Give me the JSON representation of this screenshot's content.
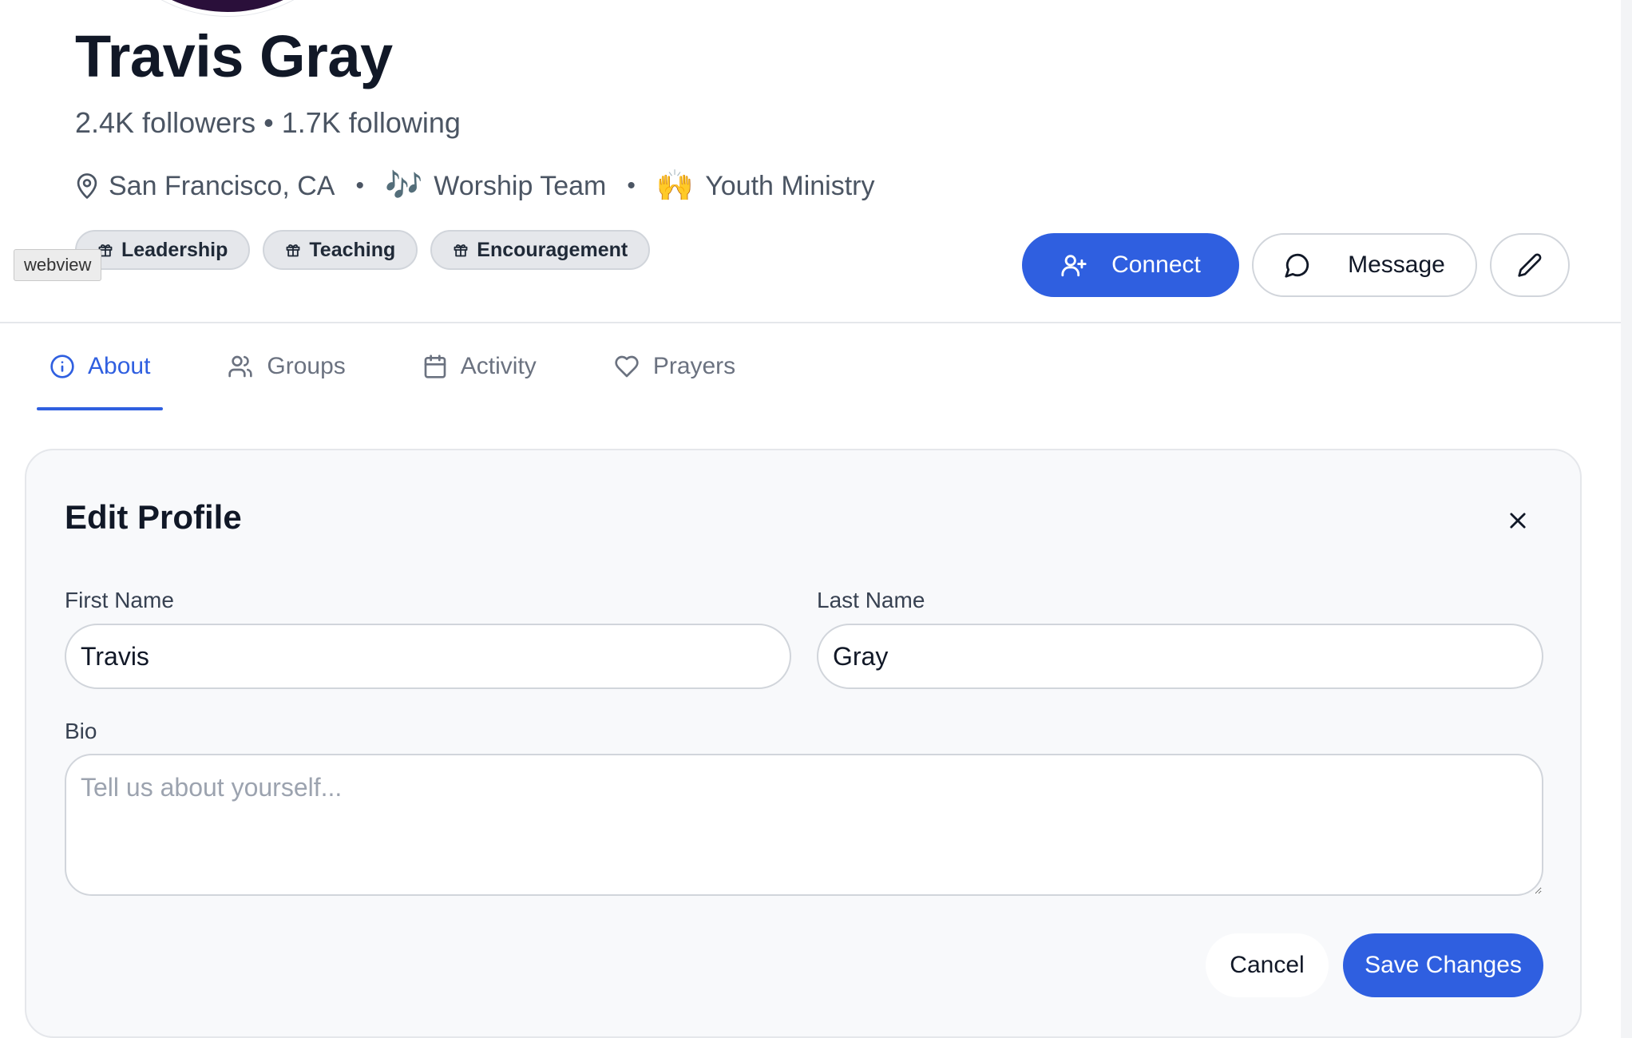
{
  "profile": {
    "name": "Travis Gray",
    "followers": "2.4K followers",
    "separator": "•",
    "following": "1.7K following",
    "location": "San Francisco, CA",
    "ministries": [
      {
        "emoji": "🎶",
        "label": "Worship Team"
      },
      {
        "emoji": "🙌",
        "label": "Youth Ministry"
      }
    ],
    "gifts": [
      "Leadership",
      "Teaching",
      "Encouragement"
    ]
  },
  "tooltip": "webview",
  "actions": {
    "connect": "Connect",
    "message": "Message"
  },
  "tabs": [
    {
      "label": "About",
      "icon": "info-icon",
      "active": true
    },
    {
      "label": "Groups",
      "icon": "users-icon",
      "active": false
    },
    {
      "label": "Activity",
      "icon": "calendar-icon",
      "active": false
    },
    {
      "label": "Prayers",
      "icon": "heart-icon",
      "active": false
    }
  ],
  "edit_form": {
    "title": "Edit Profile",
    "first_name_label": "First Name",
    "first_name_value": "Travis",
    "last_name_label": "Last Name",
    "last_name_value": "Gray",
    "bio_label": "Bio",
    "bio_placeholder": "Tell us about yourself...",
    "cancel_label": "Cancel",
    "save_label": "Save Changes"
  },
  "colors": {
    "accent": "#2f5fe0",
    "text": "#111827",
    "muted": "#4b5563"
  }
}
